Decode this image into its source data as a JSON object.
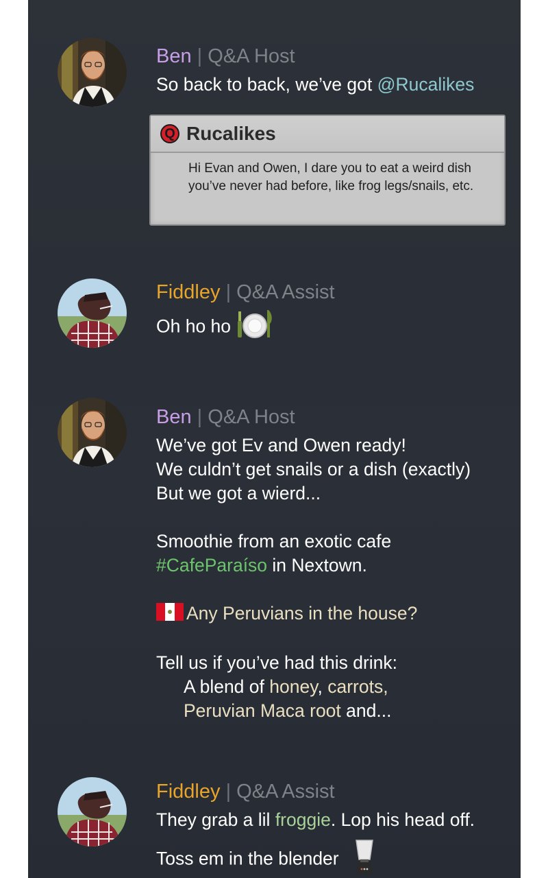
{
  "messages": [
    {
      "author": "Ben",
      "separator": "|",
      "role": "Q&A Host",
      "text_before": "So back to back, we’ve got ",
      "mention": "@Rucalikes",
      "quote": {
        "icon": "Q",
        "name": "Rucalikes",
        "body": "Hi Evan and Owen, I dare you to eat a weird dish you’ve never had before, like frog legs/snails, etc."
      }
    },
    {
      "author": "Fiddley",
      "separator": "|",
      "role": "Q&A Assist",
      "text": "Oh ho ho",
      "emoji": "fork-knife-plate-icon"
    },
    {
      "author": "Ben",
      "separator": "|",
      "role": "Q&A Host",
      "lines": [
        "We’ve got Ev and Owen ready!",
        "We culdn’t get snails or a dish (exactly)",
        "But we got a wierd..."
      ],
      "smoothie_line": "Smoothie from an exotic cafe",
      "hashtag": "#CafeParaíso",
      "location": " in Nextown.",
      "peru_question": "Any Peruvians in the house?",
      "drink_intro": "Tell us if you’ve had this drink:",
      "blend_prefix": "A blend of ",
      "honey": "honey",
      "comma1": ", ",
      "carrots": "carrots",
      "comma2": ",",
      "maca": "Peruvian Maca root",
      "and_more": " and..."
    },
    {
      "author": "Fiddley",
      "separator": "|",
      "role": "Q&A Assist",
      "line1_before": "They grab a lil ",
      "froggie": "froggie",
      "line1_after": ". Lop his head off.",
      "line2": "Toss em in the blender",
      "emoji": "blender-icon"
    }
  ],
  "colors": {
    "ben": "#c89ee6",
    "fiddley": "#e8a52a",
    "mention": "#8ec9d0",
    "hashtag": "#6cc46c",
    "highlight": "#eadfc0",
    "froggie": "#a9d29a"
  }
}
